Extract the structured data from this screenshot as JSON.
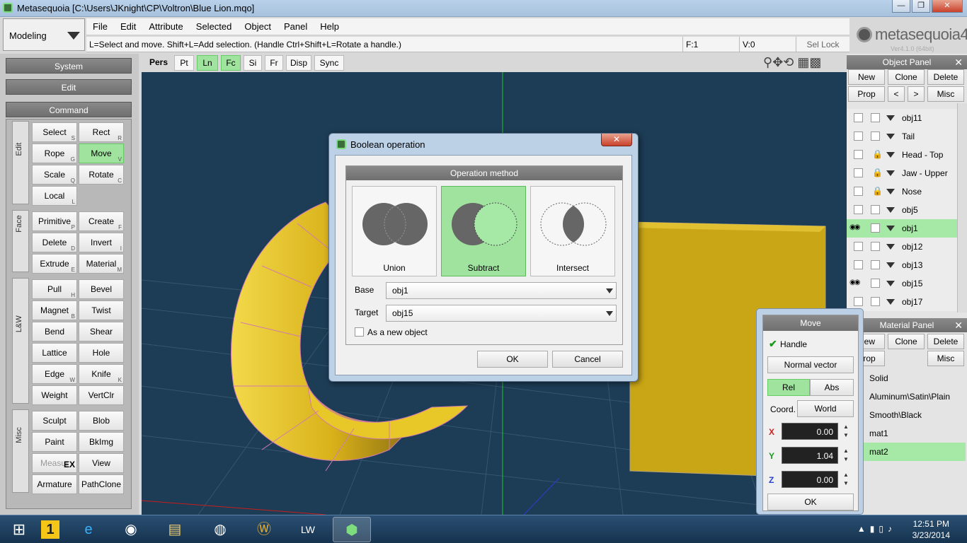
{
  "window": {
    "title": "Metasequoia [C:\\Users\\JKnight\\CP\\Voltron\\Blue Lion.mqo]",
    "min": "—",
    "max": "❐",
    "close": "✕"
  },
  "mode": {
    "selected": "Modeling"
  },
  "menu": [
    "File",
    "Edit",
    "Attribute",
    "Selected",
    "Object",
    "Panel",
    "Help"
  ],
  "status": {
    "hint": "L=Select and move.  Shift+L=Add selection.  (Handle Ctrl+Shift+L=Rotate a handle.)",
    "faces": "F:1",
    "verts": "V:0",
    "sel_lock": "Sel Lock"
  },
  "logo": {
    "text": "metasequoia4",
    "version": "Ver4.1.0 (64bit)"
  },
  "left": {
    "system": "System",
    "edit": "Edit",
    "command": "Command",
    "groups": {
      "edit": "Edit",
      "face": "Face",
      "lw": "L&W",
      "misc": "Misc"
    },
    "buttons": [
      {
        "label": "Select",
        "key": "S"
      },
      {
        "label": "Rect",
        "key": "R"
      },
      {
        "label": "Rope",
        "key": "G"
      },
      {
        "label": "Move",
        "key": "V"
      },
      {
        "label": "Scale",
        "key": "Q"
      },
      {
        "label": "Rotate",
        "key": "C"
      },
      {
        "label": "Local",
        "key": "L"
      },
      {
        "label": "Primitive",
        "key": "P"
      },
      {
        "label": "Create",
        "key": "F"
      },
      {
        "label": "Delete",
        "key": "D"
      },
      {
        "label": "Invert",
        "key": "I"
      },
      {
        "label": "Extrude",
        "key": "E"
      },
      {
        "label": "Material",
        "key": "M"
      },
      {
        "label": "Pull",
        "key": "H"
      },
      {
        "label": "Bevel",
        "key": ""
      },
      {
        "label": "Magnet",
        "key": "B"
      },
      {
        "label": "Twist",
        "key": ""
      },
      {
        "label": "Bend",
        "key": ""
      },
      {
        "label": "Shear",
        "key": ""
      },
      {
        "label": "Lattice",
        "key": ""
      },
      {
        "label": "Hole",
        "key": ""
      },
      {
        "label": "Edge",
        "key": "W"
      },
      {
        "label": "Knife",
        "key": "K"
      },
      {
        "label": "Weight",
        "key": ""
      },
      {
        "label": "VertClr",
        "key": ""
      },
      {
        "label": "Sculpt",
        "key": ""
      },
      {
        "label": "Blob",
        "key": ""
      },
      {
        "label": "Paint",
        "key": ""
      },
      {
        "label": "BkImg",
        "key": ""
      },
      {
        "label": "Measur",
        "key": "EX"
      },
      {
        "label": "View",
        "key": ""
      },
      {
        "label": "Armature",
        "key": ""
      },
      {
        "label": "PathClone",
        "key": ""
      }
    ]
  },
  "viewtools": [
    "Pers",
    "Pt",
    "Ln",
    "Fc",
    "Si",
    "Fr",
    "Disp",
    "Sync"
  ],
  "object_panel": {
    "title": "Object Panel",
    "close": "✕",
    "buttons": [
      "New",
      "Clone",
      "Delete",
      "Prop",
      "<",
      ">",
      "Misc"
    ],
    "rows": [
      {
        "name": "obj11",
        "lock": false,
        "eye": false
      },
      {
        "name": "Tail",
        "lock": false,
        "eye": false
      },
      {
        "name": "Head - Top",
        "lock": true,
        "eye": false
      },
      {
        "name": "Jaw - Upper",
        "lock": true,
        "eye": false
      },
      {
        "name": "Nose",
        "lock": true,
        "eye": false
      },
      {
        "name": "obj5",
        "lock": false,
        "eye": false
      },
      {
        "name": "obj1",
        "lock": false,
        "eye": true
      },
      {
        "name": "obj12",
        "lock": false,
        "eye": false
      },
      {
        "name": "obj13",
        "lock": false,
        "eye": false
      },
      {
        "name": "obj15",
        "lock": false,
        "eye": true
      },
      {
        "name": "obj17",
        "lock": false,
        "eye": false
      }
    ]
  },
  "material_panel": {
    "title": "Material Panel",
    "close": "✕",
    "buttons": [
      "New",
      "Clone",
      "Delete",
      "Prop",
      "Misc"
    ],
    "rows": [
      "Solid",
      "Aluminum\\Satin\\Plain",
      "Smooth\\Black",
      "mat1",
      "mat2"
    ]
  },
  "dialog": {
    "title": "Boolean operation",
    "close": "✕",
    "section": "Operation method",
    "options": [
      "Union",
      "Subtract",
      "Intersect"
    ],
    "base_label": "Base",
    "base_value": "obj1",
    "target_label": "Target",
    "target_value": "obj15",
    "new_object": "As a new object",
    "ok": "OK",
    "cancel": "Cancel"
  },
  "move": {
    "title": "Move",
    "handle": "Handle",
    "normal": "Normal vector",
    "rel": "Rel",
    "abs": "Abs",
    "coord": "Coord.",
    "world": "World",
    "x": "0.00",
    "y": "1.04",
    "z": "0.00",
    "ok": "OK"
  },
  "taskbar": {
    "time": "12:51 PM",
    "date": "3/23/2014"
  },
  "colors": {
    "accent_green": "#9fe39f",
    "viewport": "#1d3c55",
    "mesh": "#e5c21c"
  }
}
